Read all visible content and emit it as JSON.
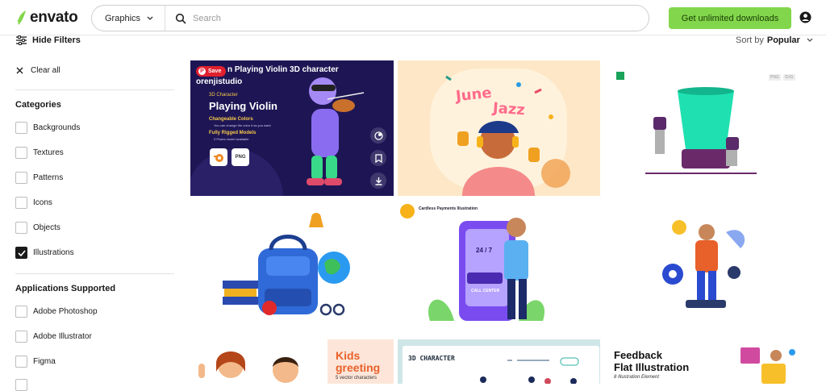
{
  "header": {
    "logo_text": "envato",
    "category_label": "Graphics",
    "search_placeholder": "Search",
    "cta_label": "Get unlimited downloads"
  },
  "sidebar": {
    "hide_filters_label": "Hide Filters",
    "clear_all_label": "Clear all",
    "categories_title": "Categories",
    "categories": [
      {
        "label": "Backgrounds",
        "checked": false
      },
      {
        "label": "Textures",
        "checked": false
      },
      {
        "label": "Patterns",
        "checked": false
      },
      {
        "label": "Icons",
        "checked": false
      },
      {
        "label": "Objects",
        "checked": false
      },
      {
        "label": "Illustrations",
        "checked": true
      }
    ],
    "applications_title": "Applications Supported",
    "applications": [
      {
        "label": "Adobe Photoshop",
        "checked": false
      },
      {
        "label": "Adobe Illustrator",
        "checked": false
      },
      {
        "label": "Figma",
        "checked": false
      }
    ]
  },
  "sort": {
    "prefix": "Sort by",
    "value": "Popular"
  },
  "tiles": {
    "t1": {
      "save_label": "Save",
      "title": "n Playing Violin 3D character",
      "author": "orenjistudio",
      "small_label": "3D Character",
      "big_label": "Playing Violin",
      "feature1": "Changeable Colors",
      "feature1_sub": "You can change the color it as you want",
      "feature2": "Fully Rigged Models",
      "feature2_sub": "3 Poses model available",
      "badge_png": "PNG"
    },
    "t2": {
      "word1": "June",
      "word2": "Jazz"
    },
    "t3": {
      "tag1": "PNG",
      "tag2": "SVG"
    },
    "t5": {
      "heading": "Cardless Payments Illustration",
      "screen_text": "24 / 7",
      "call_label": "CALL CENTER"
    },
    "t7": {
      "title1": "Kids",
      "title2": "greeting",
      "sub": "5 vector characters"
    },
    "t8": {
      "text": "3D CHARACTER"
    },
    "t9": {
      "title1": "Feedback",
      "title2": "Flat Illustration",
      "sub": "8 Illustration Element"
    }
  },
  "colors": {
    "brand_green": "#82d64b",
    "checked_box": "#1a1a1a",
    "save_red": "#e0202e"
  }
}
